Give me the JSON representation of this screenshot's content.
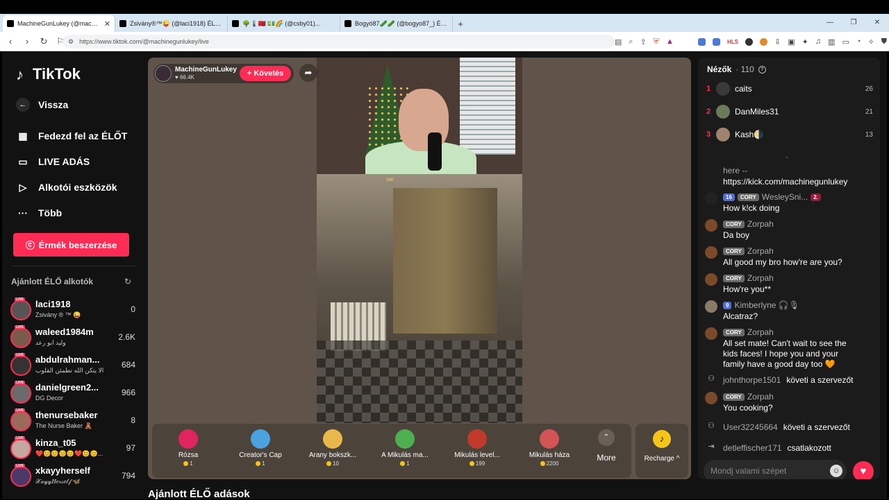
{
  "browser": {
    "tabs": [
      {
        "label": "MachineGunLukey (@machin...",
        "active": true
      },
      {
        "label": "Zsivány®™😜 (@laci1918) ÉLŐ adás...",
        "active": false
      },
      {
        "label": "🌳🌡🇲🇦 💵🌈 (@csby01)...",
        "active": false
      },
      {
        "label": "Bogyó87🥒🥒 (@bogyo87_) ÉLŐ ad...",
        "active": false
      }
    ],
    "new_tab": "+",
    "url": "https://www.tiktok.com/@machinegunlukey/live"
  },
  "sidebar": {
    "logo_text": "TikTok",
    "back": "Vissza",
    "menu": [
      {
        "label": "Fedezd fel az ÉLŐT",
        "icon": "calendar-live-icon"
      },
      {
        "label": "LIVE ADÁS",
        "icon": "camera-icon"
      },
      {
        "label": "Alkotói eszközök",
        "icon": "creator-tools-icon"
      },
      {
        "label": "Több",
        "icon": "more-dots-icon"
      }
    ],
    "coins_button": "Érmék beszerzése",
    "recommended_title": "Ajánlott ÉLŐ alkotók",
    "creators": [
      {
        "name": "laci1918",
        "sub": "Zsivány ® ™ 😜",
        "count": "0",
        "color": "#555555"
      },
      {
        "name": "waleed1984m",
        "sub": "وليد ابو رعد",
        "count": "2.6K",
        "color": "#7a5a4a"
      },
      {
        "name": "abdulrahman...",
        "sub": "الا يتكن الله تطمئن القلوب",
        "count": "684",
        "color": "#333333"
      },
      {
        "name": "danielgreen2...",
        "sub": "DG Decor",
        "count": "966",
        "color": "#6b6b6b"
      },
      {
        "name": "thenursebaker",
        "sub": "The Nurse Baker 🧸",
        "count": "8",
        "color": "#9a6b5a"
      },
      {
        "name": "kinza_t05",
        "sub": "❤️😊😊😊😊❤️😊😊...",
        "count": "97",
        "color": "#c4a8a0"
      },
      {
        "name": "xkayyherself",
        "sub": "𝒳𝒶𝓎𝓎𝐻𝑒𝓇𝓈𝑒𝓁𝒻 🦋",
        "count": "794",
        "color": "#4a3a6a"
      }
    ],
    "live_badge": "LIVE"
  },
  "stream": {
    "host_name": "MachineGunLukey",
    "host_likes": "66.4K",
    "follow": "+ Követés",
    "hud_text": "248"
  },
  "gifts": [
    {
      "name": "Rózsa",
      "price": "1",
      "color": "#e0245e"
    },
    {
      "name": "Creator's Cap",
      "price": "1",
      "color": "#4aa3df"
    },
    {
      "name": "Arany bokszk...",
      "price": "10",
      "color": "#e8b84a"
    },
    {
      "name": "A Mikulás ma...",
      "price": "1",
      "color": "#4caf50"
    },
    {
      "name": "Mikulás level...",
      "price": "199",
      "color": "#c0392b"
    },
    {
      "name": "Mikulás háza",
      "price": "2200",
      "color": "#d35454"
    }
  ],
  "more_label": "More",
  "recharge_label": "Recharge ^",
  "bottom_title": "Ajánlott ÉLŐ adások",
  "viewers": {
    "title": "Nézők",
    "count": "· 110",
    "top": [
      {
        "rank": "1",
        "name": "caits",
        "score": "26",
        "color": "#3a3a3a"
      },
      {
        "rank": "2",
        "name": "DanMiles31",
        "score": "21",
        "color": "#6a7a5a"
      },
      {
        "rank": "3",
        "name": "Kash🌗",
        "score": "13",
        "color": "#a0826d"
      }
    ]
  },
  "chat": {
    "partial_top": "here --",
    "partial_link": "https://kick.com/machinegunlukey",
    "messages": [
      {
        "badges": [
          "16",
          "CORY"
        ],
        "user": "WesleySni...",
        "extra": "2.",
        "text": "How k!ck doing",
        "color": "#222222"
      },
      {
        "badges": [
          "CORY"
        ],
        "user": "Zorpah",
        "text": "Da boy",
        "color": "#7a4a2a"
      },
      {
        "badges": [
          "CORY"
        ],
        "user": "Zorpah",
        "text": "All good my bro how're are you?",
        "color": "#7a4a2a"
      },
      {
        "badges": [
          "CORY"
        ],
        "user": "Zorpah",
        "text": "How're you**",
        "color": "#7a4a2a"
      },
      {
        "badges": [
          "9"
        ],
        "user": "Kimberlyne 🎧🎙",
        "text": "Alcatraz?",
        "color": "#8a7a6a"
      },
      {
        "badges": [
          "CORY"
        ],
        "user": "Zorpah",
        "text": "All set mate! Can't wait to see the kids faces! I hope you and your family have a good day too 🧡",
        "color": "#7a4a2a"
      }
    ],
    "system1": {
      "user": "johnthorpe1501",
      "action": "követi a szervezőt"
    },
    "msg_after": {
      "badges": [
        "CORY"
      ],
      "user": "Zorpah",
      "text": "You cooking?",
      "color": "#7a4a2a"
    },
    "system2": {
      "user": "User32245664",
      "action": "követi a szervezőt"
    },
    "system3": {
      "user": "detleffischer171",
      "action": "csatlakozott"
    },
    "placeholder": "Mondj valami szépet"
  }
}
